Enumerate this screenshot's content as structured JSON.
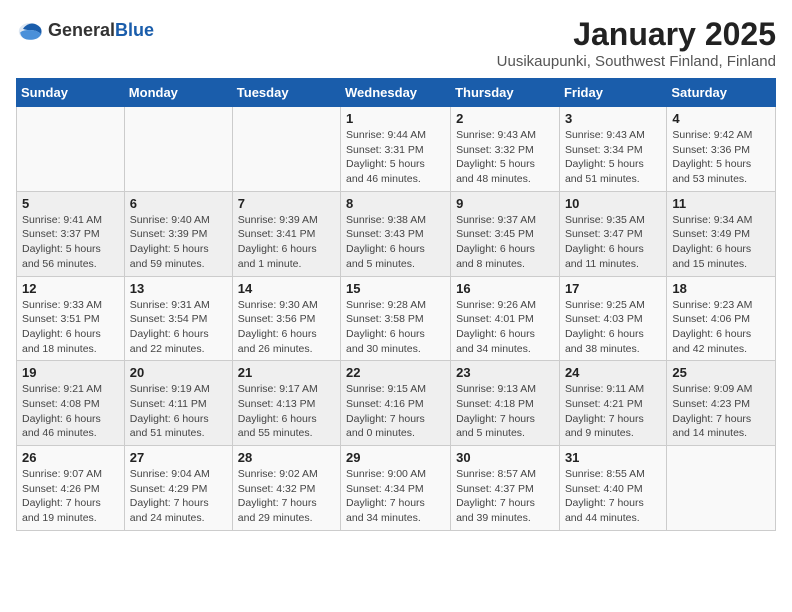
{
  "logo": {
    "general": "General",
    "blue": "Blue"
  },
  "title": "January 2025",
  "location": "Uusikaupunki, Southwest Finland, Finland",
  "days_of_week": [
    "Sunday",
    "Monday",
    "Tuesday",
    "Wednesday",
    "Thursday",
    "Friday",
    "Saturday"
  ],
  "weeks": [
    [
      {
        "day": "",
        "detail": ""
      },
      {
        "day": "",
        "detail": ""
      },
      {
        "day": "",
        "detail": ""
      },
      {
        "day": "1",
        "detail": "Sunrise: 9:44 AM\nSunset: 3:31 PM\nDaylight: 5 hours and 46 minutes."
      },
      {
        "day": "2",
        "detail": "Sunrise: 9:43 AM\nSunset: 3:32 PM\nDaylight: 5 hours and 48 minutes."
      },
      {
        "day": "3",
        "detail": "Sunrise: 9:43 AM\nSunset: 3:34 PM\nDaylight: 5 hours and 51 minutes."
      },
      {
        "day": "4",
        "detail": "Sunrise: 9:42 AM\nSunset: 3:36 PM\nDaylight: 5 hours and 53 minutes."
      }
    ],
    [
      {
        "day": "5",
        "detail": "Sunrise: 9:41 AM\nSunset: 3:37 PM\nDaylight: 5 hours and 56 minutes."
      },
      {
        "day": "6",
        "detail": "Sunrise: 9:40 AM\nSunset: 3:39 PM\nDaylight: 5 hours and 59 minutes."
      },
      {
        "day": "7",
        "detail": "Sunrise: 9:39 AM\nSunset: 3:41 PM\nDaylight: 6 hours and 1 minute."
      },
      {
        "day": "8",
        "detail": "Sunrise: 9:38 AM\nSunset: 3:43 PM\nDaylight: 6 hours and 5 minutes."
      },
      {
        "day": "9",
        "detail": "Sunrise: 9:37 AM\nSunset: 3:45 PM\nDaylight: 6 hours and 8 minutes."
      },
      {
        "day": "10",
        "detail": "Sunrise: 9:35 AM\nSunset: 3:47 PM\nDaylight: 6 hours and 11 minutes."
      },
      {
        "day": "11",
        "detail": "Sunrise: 9:34 AM\nSunset: 3:49 PM\nDaylight: 6 hours and 15 minutes."
      }
    ],
    [
      {
        "day": "12",
        "detail": "Sunrise: 9:33 AM\nSunset: 3:51 PM\nDaylight: 6 hours and 18 minutes."
      },
      {
        "day": "13",
        "detail": "Sunrise: 9:31 AM\nSunset: 3:54 PM\nDaylight: 6 hours and 22 minutes."
      },
      {
        "day": "14",
        "detail": "Sunrise: 9:30 AM\nSunset: 3:56 PM\nDaylight: 6 hours and 26 minutes."
      },
      {
        "day": "15",
        "detail": "Sunrise: 9:28 AM\nSunset: 3:58 PM\nDaylight: 6 hours and 30 minutes."
      },
      {
        "day": "16",
        "detail": "Sunrise: 9:26 AM\nSunset: 4:01 PM\nDaylight: 6 hours and 34 minutes."
      },
      {
        "day": "17",
        "detail": "Sunrise: 9:25 AM\nSunset: 4:03 PM\nDaylight: 6 hours and 38 minutes."
      },
      {
        "day": "18",
        "detail": "Sunrise: 9:23 AM\nSunset: 4:06 PM\nDaylight: 6 hours and 42 minutes."
      }
    ],
    [
      {
        "day": "19",
        "detail": "Sunrise: 9:21 AM\nSunset: 4:08 PM\nDaylight: 6 hours and 46 minutes."
      },
      {
        "day": "20",
        "detail": "Sunrise: 9:19 AM\nSunset: 4:11 PM\nDaylight: 6 hours and 51 minutes."
      },
      {
        "day": "21",
        "detail": "Sunrise: 9:17 AM\nSunset: 4:13 PM\nDaylight: 6 hours and 55 minutes."
      },
      {
        "day": "22",
        "detail": "Sunrise: 9:15 AM\nSunset: 4:16 PM\nDaylight: 7 hours and 0 minutes."
      },
      {
        "day": "23",
        "detail": "Sunrise: 9:13 AM\nSunset: 4:18 PM\nDaylight: 7 hours and 5 minutes."
      },
      {
        "day": "24",
        "detail": "Sunrise: 9:11 AM\nSunset: 4:21 PM\nDaylight: 7 hours and 9 minutes."
      },
      {
        "day": "25",
        "detail": "Sunrise: 9:09 AM\nSunset: 4:23 PM\nDaylight: 7 hours and 14 minutes."
      }
    ],
    [
      {
        "day": "26",
        "detail": "Sunrise: 9:07 AM\nSunset: 4:26 PM\nDaylight: 7 hours and 19 minutes."
      },
      {
        "day": "27",
        "detail": "Sunrise: 9:04 AM\nSunset: 4:29 PM\nDaylight: 7 hours and 24 minutes."
      },
      {
        "day": "28",
        "detail": "Sunrise: 9:02 AM\nSunset: 4:32 PM\nDaylight: 7 hours and 29 minutes."
      },
      {
        "day": "29",
        "detail": "Sunrise: 9:00 AM\nSunset: 4:34 PM\nDaylight: 7 hours and 34 minutes."
      },
      {
        "day": "30",
        "detail": "Sunrise: 8:57 AM\nSunset: 4:37 PM\nDaylight: 7 hours and 39 minutes."
      },
      {
        "day": "31",
        "detail": "Sunrise: 8:55 AM\nSunset: 4:40 PM\nDaylight: 7 hours and 44 minutes."
      },
      {
        "day": "",
        "detail": ""
      }
    ]
  ]
}
